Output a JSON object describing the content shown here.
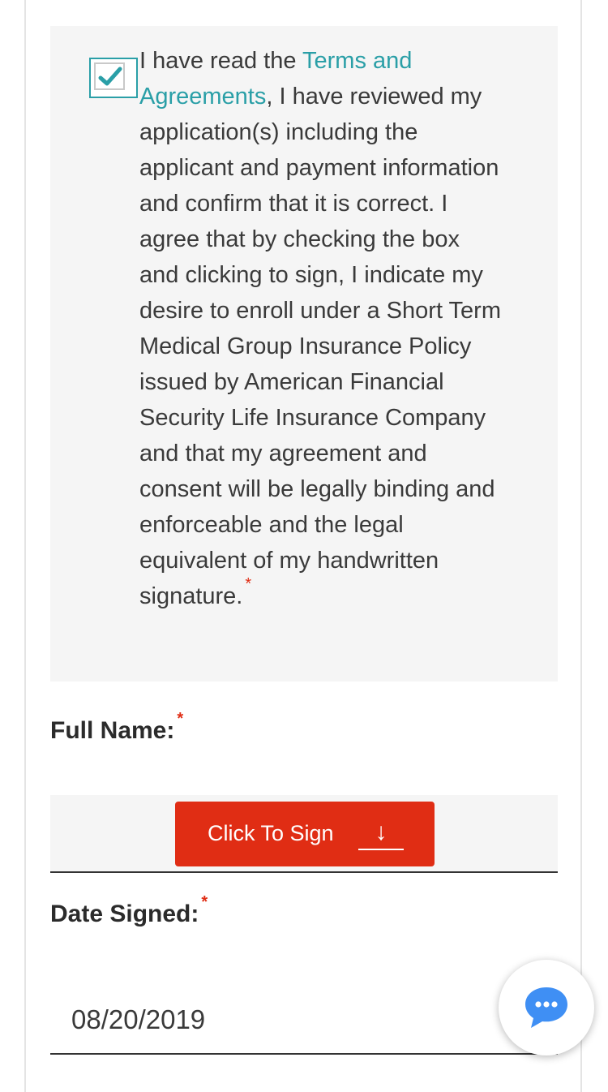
{
  "consent": {
    "checked": true,
    "text_before": "I have read the ",
    "terms_link": "Terms and Agreements",
    "text_after": ", I have reviewed my application(s) including the applicant and payment information and confirm that it is correct. I agree that by checking the box and clicking to sign, I indicate my desire to enroll under a Short Term Medical Group Insurance Policy issued by American Financial Security Life Insurance Company and that my agreement and consent will be legally binding and enforceable and the legal equivalent of my handwritten signature.",
    "required_mark": "*"
  },
  "full_name": {
    "label": "Full Name:",
    "required_mark": "*",
    "sign_button_label": "Click To Sign",
    "sign_button_icon": "down-arrow-icon",
    "sign_button_arrow": "↓"
  },
  "date_signed": {
    "label": "Date Signed:",
    "required_mark": "*",
    "value": "08/20/2019"
  },
  "chat": {
    "icon": "chat-bubble-icon"
  },
  "colors": {
    "accent": "#2a9fa7",
    "button": "#e02d14",
    "required": "#e02d14"
  }
}
